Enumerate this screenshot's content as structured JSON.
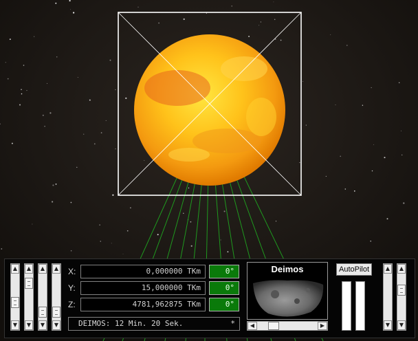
{
  "coords": [
    {
      "axis": "X:",
      "value": "0,000000  TKm",
      "angle": "0°"
    },
    {
      "axis": "Y:",
      "value": "15,000000  TKm",
      "angle": "0°"
    },
    {
      "axis": "Z:",
      "value": "4781,962875  TKm",
      "angle": "0°"
    }
  ],
  "status": {
    "text": "DEIMOS: 12 Min. 20 Sek.",
    "marker": "*"
  },
  "target": {
    "name": "Deimos"
  },
  "autopilot": {
    "label": "AutoPilot"
  },
  "scroll": {
    "up": "▲",
    "down": "▼",
    "left": "◀",
    "right": "▶"
  },
  "colors": {
    "sun_core": "#ffd21a",
    "sun_edge": "#e07a00",
    "beam": "#1f9a1f",
    "frame": "#ffffff",
    "angle_bg": "#0a7a0a"
  }
}
